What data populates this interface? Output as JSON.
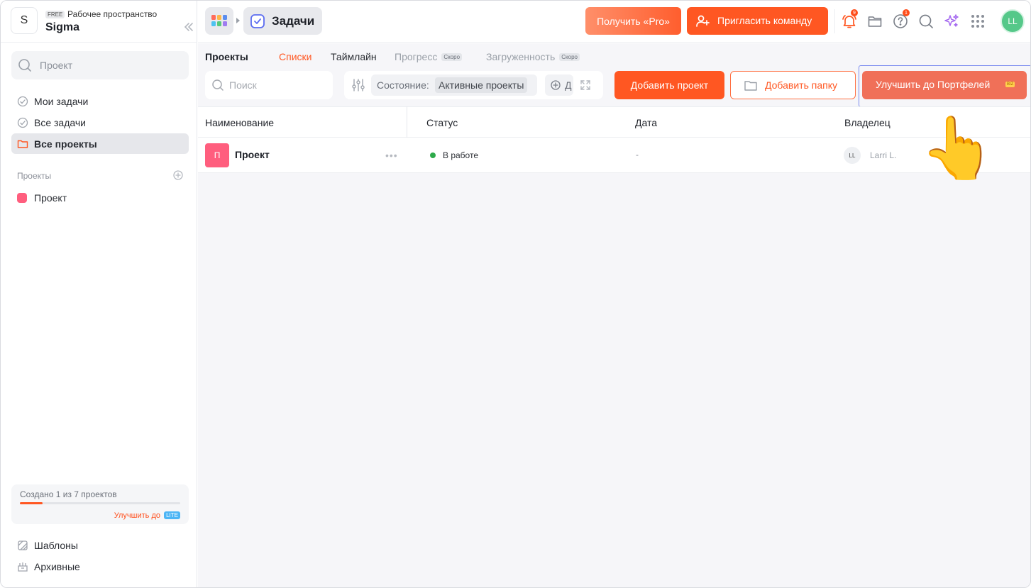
{
  "workspace": {
    "avatar_letter": "S",
    "plan_badge": "FREE",
    "subtitle": "Рабочее пространство",
    "name": "Sigma"
  },
  "sidebar": {
    "search_placeholder": "Проект",
    "nav": [
      {
        "label": "Мои задачи",
        "icon": "check-circle-icon"
      },
      {
        "label": "Все задачи",
        "icon": "check-circle-icon"
      },
      {
        "label": "Все проекты",
        "icon": "folder-icon",
        "active": true
      }
    ],
    "projects_section_label": "Проекты",
    "projects": [
      {
        "label": "Проект",
        "color": "#ff5e7e"
      }
    ],
    "quota": {
      "text": "Создано 1 из 7 проектов",
      "used": 1,
      "total": 7,
      "upgrade_label": "Улучшить до",
      "upgrade_badge": "LITE"
    },
    "bottom": [
      {
        "label": "Шаблоны",
        "icon": "templates-icon"
      },
      {
        "label": "Архивные",
        "icon": "archive-icon"
      }
    ]
  },
  "topbar": {
    "breadcrumb_current": "Задачи",
    "get_pro_label": "Получить «Pro»",
    "invite_label": "Пригласить команду",
    "notifications_count": "9",
    "help_count": "1",
    "user_initials": "LL"
  },
  "main": {
    "tabs": [
      {
        "label": "Проекты",
        "state": "title"
      },
      {
        "label": "Списки",
        "state": "active"
      },
      {
        "label": "Таймлайн",
        "state": "normal"
      },
      {
        "label": "Прогресс",
        "state": "disabled",
        "badge": "Скоро"
      },
      {
        "label": "Загруженность",
        "state": "disabled",
        "badge": "Скоро"
      }
    ],
    "search_placeholder": "Поиск",
    "filter": {
      "key": "Состояние:",
      "value": "Активные проекты",
      "add_label": "Д"
    },
    "add_project_label": "Добавить проект",
    "add_folder_label": "Добавить папку",
    "upgrade_label": "Улучшить до Портфелей",
    "upgrade_badge": "BIZ"
  },
  "table": {
    "columns": [
      "Наименование",
      "Статус",
      "Дата",
      "Владелец"
    ],
    "rows": [
      {
        "icon_letter": "П",
        "name": "Проект",
        "status": "В работе",
        "date": "-",
        "owner_initials": "LL",
        "owner_name": "Larri L."
      }
    ]
  },
  "colors": {
    "accent": "#ff5722",
    "status_in_progress": "#2eaa4a",
    "project_color": "#ff5e7e",
    "focus_outline": "#7b8cf0"
  },
  "pointer_icon": "👆"
}
